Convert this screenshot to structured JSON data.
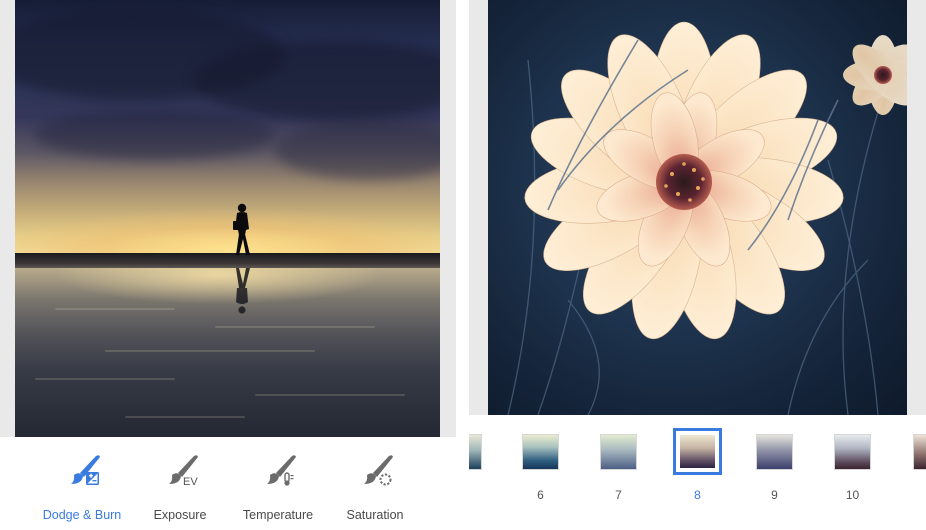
{
  "toolbar": {
    "tools": [
      {
        "label": "Dodge & Burn",
        "icon": "brush-dodge-burn-icon",
        "active": true
      },
      {
        "label": "Exposure",
        "icon": "brush-exposure-icon",
        "active": false
      },
      {
        "label": "Temperature",
        "icon": "brush-temperature-icon",
        "active": false
      },
      {
        "label": "Saturation",
        "icon": "brush-saturation-icon",
        "active": false
      }
    ],
    "exposure_badge": "EV"
  },
  "filters": {
    "items": [
      {
        "label": "6"
      },
      {
        "label": "7"
      },
      {
        "label": "8",
        "selected": true
      },
      {
        "label": "9"
      },
      {
        "label": "10"
      }
    ]
  },
  "colors": {
    "accent": "#3a7be0",
    "icon_gray": "#6b6b6b",
    "panel_bg": "#e9e9e9"
  }
}
